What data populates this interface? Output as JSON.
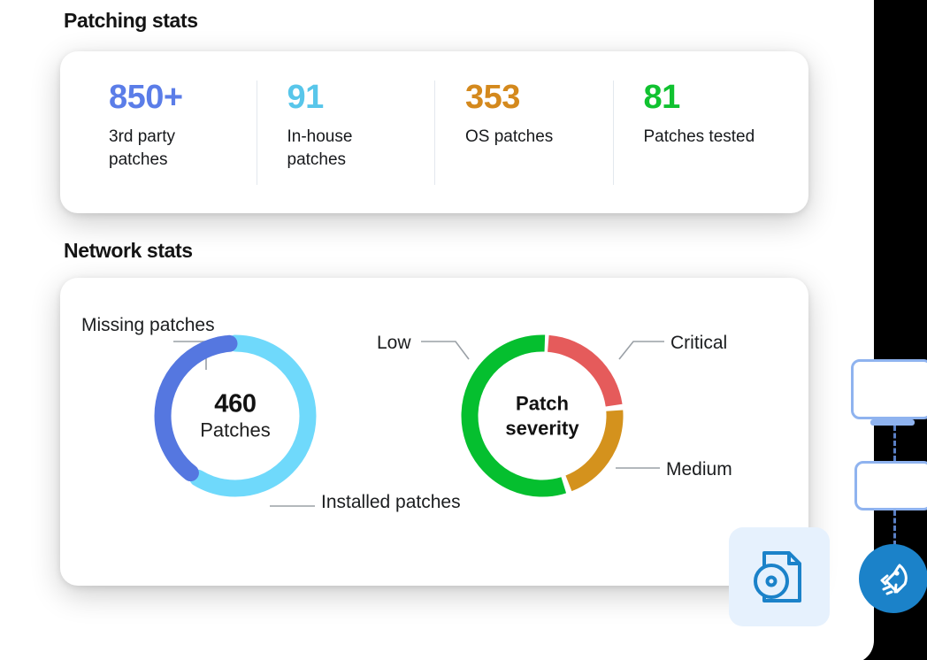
{
  "page": {
    "background_color": "#000000",
    "panel_color": "#ffffff"
  },
  "sections": {
    "patching": {
      "heading": "Patching stats"
    },
    "network": {
      "heading": "Network stats"
    }
  },
  "patching_stats": [
    {
      "value": "850+",
      "label": "3rd party patches",
      "color": "#5b7de8"
    },
    {
      "value": "91",
      "label": "In-house patches",
      "color": "#58c6ea"
    },
    {
      "value": "353",
      "label": "OS patches",
      "color": "#d4891d"
    },
    {
      "value": "81",
      "label": "Patches tested",
      "color": "#10c230"
    }
  ],
  "chart_data": [
    {
      "type": "pie",
      "name": "patches-donut",
      "title": "460",
      "subtitle": "Patches",
      "center_value": "460",
      "center_label": "Patches",
      "total": 460,
      "legend_position": "callout",
      "categories": [
        "Missing patches",
        "Installed patches"
      ],
      "values": [
        40,
        60
      ],
      "colors": [
        "#5577e0",
        "#6fd9fb"
      ],
      "labels": [
        {
          "text": "Missing patches",
          "color": "#5577e0"
        },
        {
          "text": "Installed patches",
          "color": "#6fd9fb"
        }
      ]
    },
    {
      "type": "pie",
      "name": "patch-severity-donut",
      "title": "Patch severity",
      "center_title_line1": "Patch",
      "center_title_line2": "severity",
      "legend_position": "callout",
      "categories": [
        "Critical",
        "Medium",
        "Low"
      ],
      "values": [
        22,
        21,
        57
      ],
      "colors": [
        "#e55b5b",
        "#d4921d",
        "#05bf2f"
      ],
      "labels": [
        {
          "text": "Critical",
          "color": "#e55b5b"
        },
        {
          "text": "Medium",
          "color": "#d4921d"
        },
        {
          "text": "Low",
          "color": "#05bf2f"
        }
      ]
    }
  ],
  "floating": {
    "doc_icon": "document-disc-icon",
    "doc_tile_color": "#e6f1fd",
    "doc_icon_color": "#1b82c9"
  },
  "rail": {
    "device_1": "monitor-device",
    "device_2": "device-box",
    "rocket_icon": "rocket-icon",
    "rocket_bg_color": "#1b82c9",
    "connector_color": "#5a7fc4"
  }
}
